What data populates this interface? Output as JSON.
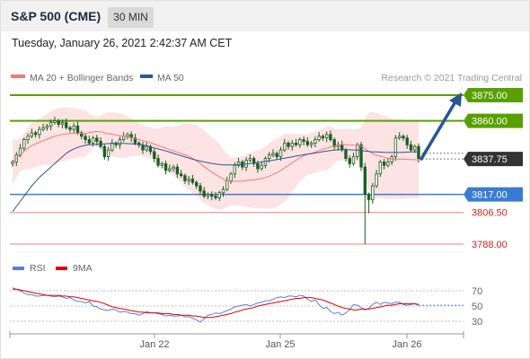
{
  "header": {
    "title": "S&P 500 (CME)",
    "timeframe": "30 MIN",
    "datetime": "Tuesday, January 26, 2021 2:42:37 AM CET"
  },
  "credit": "Research © 2021 Trading Central",
  "colors": {
    "candle": "#1b5e20",
    "bollinger_band": "#fde3e3",
    "ma20": "#ef7b7b",
    "ma50": "#2f5796",
    "resistance": "#58a000",
    "support": "#3a7bd5",
    "support_light": "#f08080",
    "arrow": "#2a5594",
    "price_tag": "#333333",
    "rsi": "#5b7fd6",
    "rsi_ma": "#e00000"
  },
  "chart_data": [
    {
      "type": "candlestick",
      "legend": [
        "MA 20 + Bollinger Bands",
        "MA 50"
      ],
      "x_ticks": [
        "Jan 22",
        "Jan 25",
        "Jan 26"
      ],
      "y_range": [
        3785,
        3880
      ],
      "levels": [
        {
          "label": "3875.00",
          "value": 3875.0,
          "kind": "resistance"
        },
        {
          "label": "3860.00",
          "value": 3860.0,
          "kind": "resistance"
        },
        {
          "label": "3837.75",
          "value": 3837.75,
          "kind": "last"
        },
        {
          "label": "3817.00",
          "value": 3817.0,
          "kind": "support"
        },
        {
          "label": "3806.50",
          "value": 3806.5,
          "kind": "support_light"
        },
        {
          "label": "3788.00",
          "value": 3788.0,
          "kind": "support_light"
        }
      ],
      "arrow": {
        "from": 3837.75,
        "to": 3875.0,
        "direction": "up"
      },
      "close": [
        3836,
        3840,
        3844,
        3849,
        3851,
        3853,
        3852,
        3855,
        3856,
        3857,
        3859,
        3860,
        3858,
        3859,
        3856,
        3855,
        3857,
        3853,
        3851,
        3849,
        3847,
        3850,
        3848,
        3845,
        3839,
        3843,
        3847,
        3846,
        3849,
        3851,
        3852,
        3850,
        3847,
        3846,
        3843,
        3845,
        3842,
        3838,
        3834,
        3835,
        3831,
        3832,
        3833,
        3829,
        3828,
        3825,
        3826,
        3824,
        3822,
        3819,
        3816,
        3817,
        3816,
        3815,
        3818,
        3820,
        3825,
        3829,
        3834,
        3836,
        3833,
        3837,
        3838,
        3835,
        3832,
        3834,
        3838,
        3840,
        3841,
        3839,
        3843,
        3847,
        3845,
        3847,
        3846,
        3849,
        3848,
        3846,
        3847,
        3849,
        3851,
        3850,
        3852,
        3849,
        3845,
        3846,
        3843,
        3838,
        3835,
        3839,
        3846,
        3833,
        3817,
        3814,
        3822,
        3829,
        3836,
        3834,
        3836,
        3839,
        3850,
        3851,
        3850,
        3846,
        3843,
        3845,
        3838
      ],
      "ma50": [
        3807,
        3810,
        3813,
        3816,
        3819,
        3822,
        3824.5,
        3827,
        3829,
        3831,
        3833,
        3835,
        3837,
        3839,
        3841,
        3842.5,
        3843.5,
        3844.5,
        3845.2,
        3845.7,
        3846,
        3846.1,
        3846.3,
        3846.4,
        3846.6,
        3846.7,
        3846.8,
        3846.8,
        3846.8,
        3846.8,
        3846.7,
        3846.6,
        3846.4,
        3846.1,
        3845.8,
        3845.4,
        3844.8,
        3844.2,
        3843.6,
        3843,
        3842.4,
        3841.7,
        3841,
        3840.3,
        3839.6,
        3838.9,
        3838.2,
        3837.6,
        3837,
        3836.5,
        3836,
        3835.5,
        3835.1,
        3834.8,
        3834.5,
        3834.3,
        3834.2,
        3834.2,
        3834.3,
        3834.4,
        3834.6,
        3834.8,
        3835,
        3835.3,
        3835.6,
        3836,
        3836.3,
        3836.7,
        3837,
        3837.4,
        3837.8,
        3838.2,
        3838.6,
        3839,
        3839.4,
        3839.8,
        3840.2,
        3840.5,
        3840.8,
        3841.2,
        3841.6,
        3842,
        3842.3,
        3842.6,
        3842.9,
        3843.1,
        3843.2,
        3843.2,
        3843.1,
        3843,
        3842.9,
        3842.7,
        3842.4,
        3842.1,
        3841.9,
        3841.8,
        3841.7,
        3841.6,
        3841.5,
        3841.5,
        3841.5,
        3841.5,
        3841.6,
        3841.7,
        3841.8,
        3841.9,
        3842
      ]
    },
    {
      "type": "line",
      "series": [
        {
          "name": "RSI"
        },
        {
          "name": "9MA"
        }
      ],
      "y_ticks": [
        "70",
        "50",
        "30"
      ],
      "rsi": [
        74,
        72,
        70,
        67,
        65,
        65,
        63,
        63,
        64,
        64,
        63,
        62,
        63,
        62,
        60,
        61,
        58,
        56,
        56,
        54,
        56,
        50,
        49,
        46,
        45,
        44,
        46,
        45,
        42,
        43,
        42,
        40,
        40,
        38,
        40,
        43,
        41,
        41,
        40,
        39,
        37,
        38,
        37,
        37,
        38,
        36,
        36,
        34,
        32,
        29,
        33,
        38,
        39,
        41,
        40,
        42,
        44,
        46,
        49,
        50,
        51,
        52,
        50,
        52,
        54,
        55,
        57,
        57,
        59,
        61,
        62,
        61,
        63,
        63,
        62,
        64,
        63,
        59,
        56,
        58,
        52,
        47,
        48,
        43,
        40,
        42,
        38,
        41,
        45,
        52,
        51,
        48,
        45,
        47,
        52,
        55,
        52,
        55,
        54,
        53,
        55,
        55,
        52,
        51,
        52,
        53,
        51
      ],
      "rsi_ma": [
        72,
        72,
        71,
        70,
        69,
        68,
        67,
        66,
        65,
        64,
        64,
        64,
        64,
        63,
        63,
        62,
        62,
        61,
        60,
        59,
        58,
        57,
        56,
        55,
        53,
        51,
        49,
        48,
        47,
        46,
        45,
        44,
        43,
        42,
        42,
        41,
        41,
        41,
        41,
        40,
        40,
        40,
        39,
        39,
        38,
        38,
        38,
        37,
        37,
        36,
        35,
        35,
        35,
        36,
        37,
        38,
        39,
        40,
        42,
        43,
        45,
        46,
        47,
        48,
        50,
        51,
        52,
        53,
        54,
        55,
        56,
        57,
        58,
        59,
        60,
        60,
        61,
        61,
        61,
        60,
        59,
        58,
        56,
        54,
        52,
        50,
        48,
        47,
        46,
        45,
        45,
        46,
        46,
        46,
        47,
        48,
        49,
        50,
        51,
        51,
        52,
        53,
        53,
        53,
        53,
        53,
        52
      ]
    }
  ]
}
